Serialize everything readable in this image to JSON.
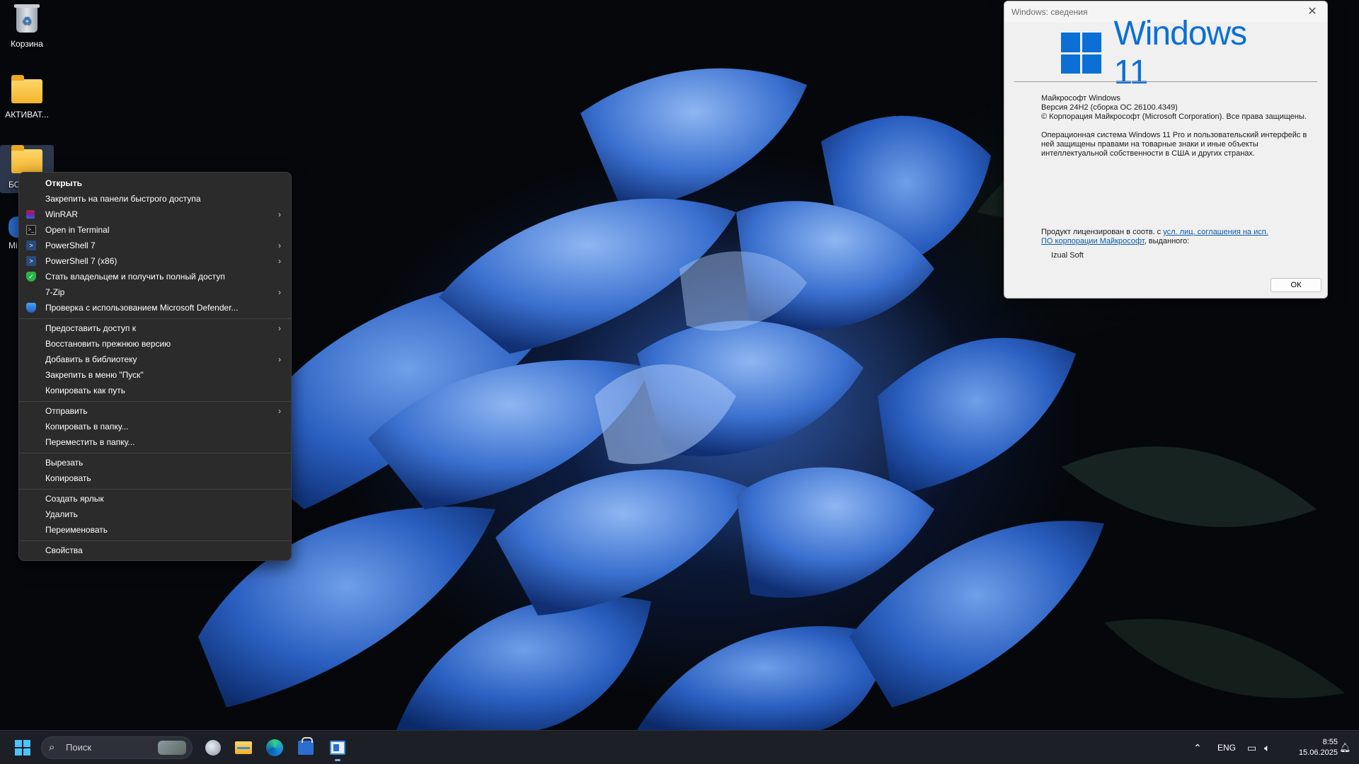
{
  "desktop": {
    "icons": [
      {
        "label": "Корзина"
      },
      {
        "label": "АКТИВАТ..."
      },
      {
        "label": "БО"
      },
      {
        "label": "Mi"
      }
    ]
  },
  "context_menu": {
    "groups": [
      [
        {
          "label": "Открыть",
          "bold": true,
          "icon": "none",
          "submenu": false
        },
        {
          "label": "Закрепить на панели быстрого доступа",
          "icon": "none",
          "submenu": false
        },
        {
          "label": "WinRAR",
          "icon": "winrar-icon",
          "submenu": true
        },
        {
          "label": "Open in Terminal",
          "icon": "terminal-icon",
          "submenu": false
        },
        {
          "label": "PowerShell 7",
          "icon": "powershell-icon",
          "submenu": true
        },
        {
          "label": "PowerShell 7 (x86)",
          "icon": "powershell-icon",
          "submenu": true
        },
        {
          "label": "Стать владельцем и получить полный доступ",
          "icon": "shield-check-icon",
          "submenu": false
        },
        {
          "label": "7-Zip",
          "icon": "none",
          "submenu": true
        },
        {
          "label": "Проверка с использованием Microsoft Defender...",
          "icon": "defender-shield-icon",
          "submenu": false
        }
      ],
      [
        {
          "label": "Предоставить доступ к",
          "icon": "none",
          "submenu": true
        },
        {
          "label": "Восстановить прежнюю версию",
          "icon": "none",
          "submenu": false
        },
        {
          "label": "Добавить в библиотеку",
          "icon": "none",
          "submenu": true
        },
        {
          "label": "Закрепить в меню \"Пуск\"",
          "icon": "none",
          "submenu": false
        },
        {
          "label": "Копировать как путь",
          "icon": "none",
          "submenu": false
        }
      ],
      [
        {
          "label": "Отправить",
          "icon": "none",
          "submenu": true
        },
        {
          "label": "Копировать в папку...",
          "icon": "none",
          "submenu": false
        },
        {
          "label": "Переместить в папку...",
          "icon": "none",
          "submenu": false
        }
      ],
      [
        {
          "label": "Вырезать",
          "icon": "none",
          "submenu": false
        },
        {
          "label": "Копировать",
          "icon": "none",
          "submenu": false
        }
      ],
      [
        {
          "label": "Создать ярлык",
          "icon": "none",
          "submenu": false
        },
        {
          "label": "Удалить",
          "icon": "none",
          "submenu": false
        },
        {
          "label": "Переименовать",
          "icon": "none",
          "submenu": false
        }
      ],
      [
        {
          "label": "Свойства",
          "icon": "none",
          "submenu": false
        }
      ]
    ]
  },
  "winver": {
    "title": "Windows: сведения",
    "logo_text": "Windows 11",
    "product": "Майкрософт Windows",
    "version": "Версия 24H2 (сборка ОС 26100.4349)",
    "copyright": "© Корпорация Майкрософт (Microsoft Corporation). Все права защищены.",
    "trademark": "Операционная система Windows 11 Pro и пользовательский интерфейс в ней защищены правами на товарные знаки и иные объекты интеллектуальной собственности в США и других странах.",
    "license_prefix": "Продукт лицензирован в соотв. с ",
    "license_link": "усл. лиц. соглашения на исп. ПО корпорации Майкрософт",
    "license_suffix": ", выданного:",
    "owner": "Izual Soft",
    "ok_label": "ОК",
    "accent": "#0b6fd6"
  },
  "taskbar": {
    "search_placeholder": "Поиск",
    "language": "ENG",
    "time": "8:55",
    "date": "15.06.2025"
  }
}
